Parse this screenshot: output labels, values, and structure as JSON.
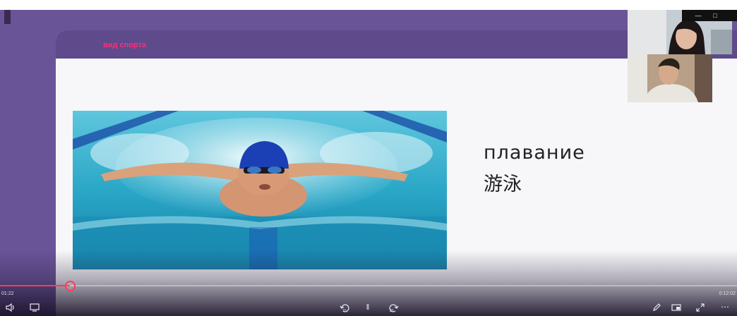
{
  "slide": {
    "title": "вид спорта",
    "word_ru": "плавание",
    "word_zh": "游泳"
  },
  "player": {
    "current_time": "01:22",
    "total_time": "0:12:02",
    "progress": 0.095,
    "colors": {
      "accent": "#ff3a57",
      "frame": "#6a5498",
      "header": "#5f4a8c"
    },
    "controls": {
      "volume_icon": "speaker-icon",
      "captions_icon": "captions-icon",
      "rewind_label": "10",
      "forward_label": "30",
      "pause_icon": "pause-icon",
      "pen_icon": "pen-icon",
      "pip_icon": "picture-in-picture-icon",
      "fullscreen_icon": "fullscreen-icon",
      "more_icon": "more-icon"
    }
  },
  "window": {
    "minimize_icon": "minimize-icon",
    "maximize_icon": "maximize-icon"
  },
  "participants": [
    {
      "name": "participant-video-1"
    },
    {
      "name": "participant-video-2"
    }
  ]
}
